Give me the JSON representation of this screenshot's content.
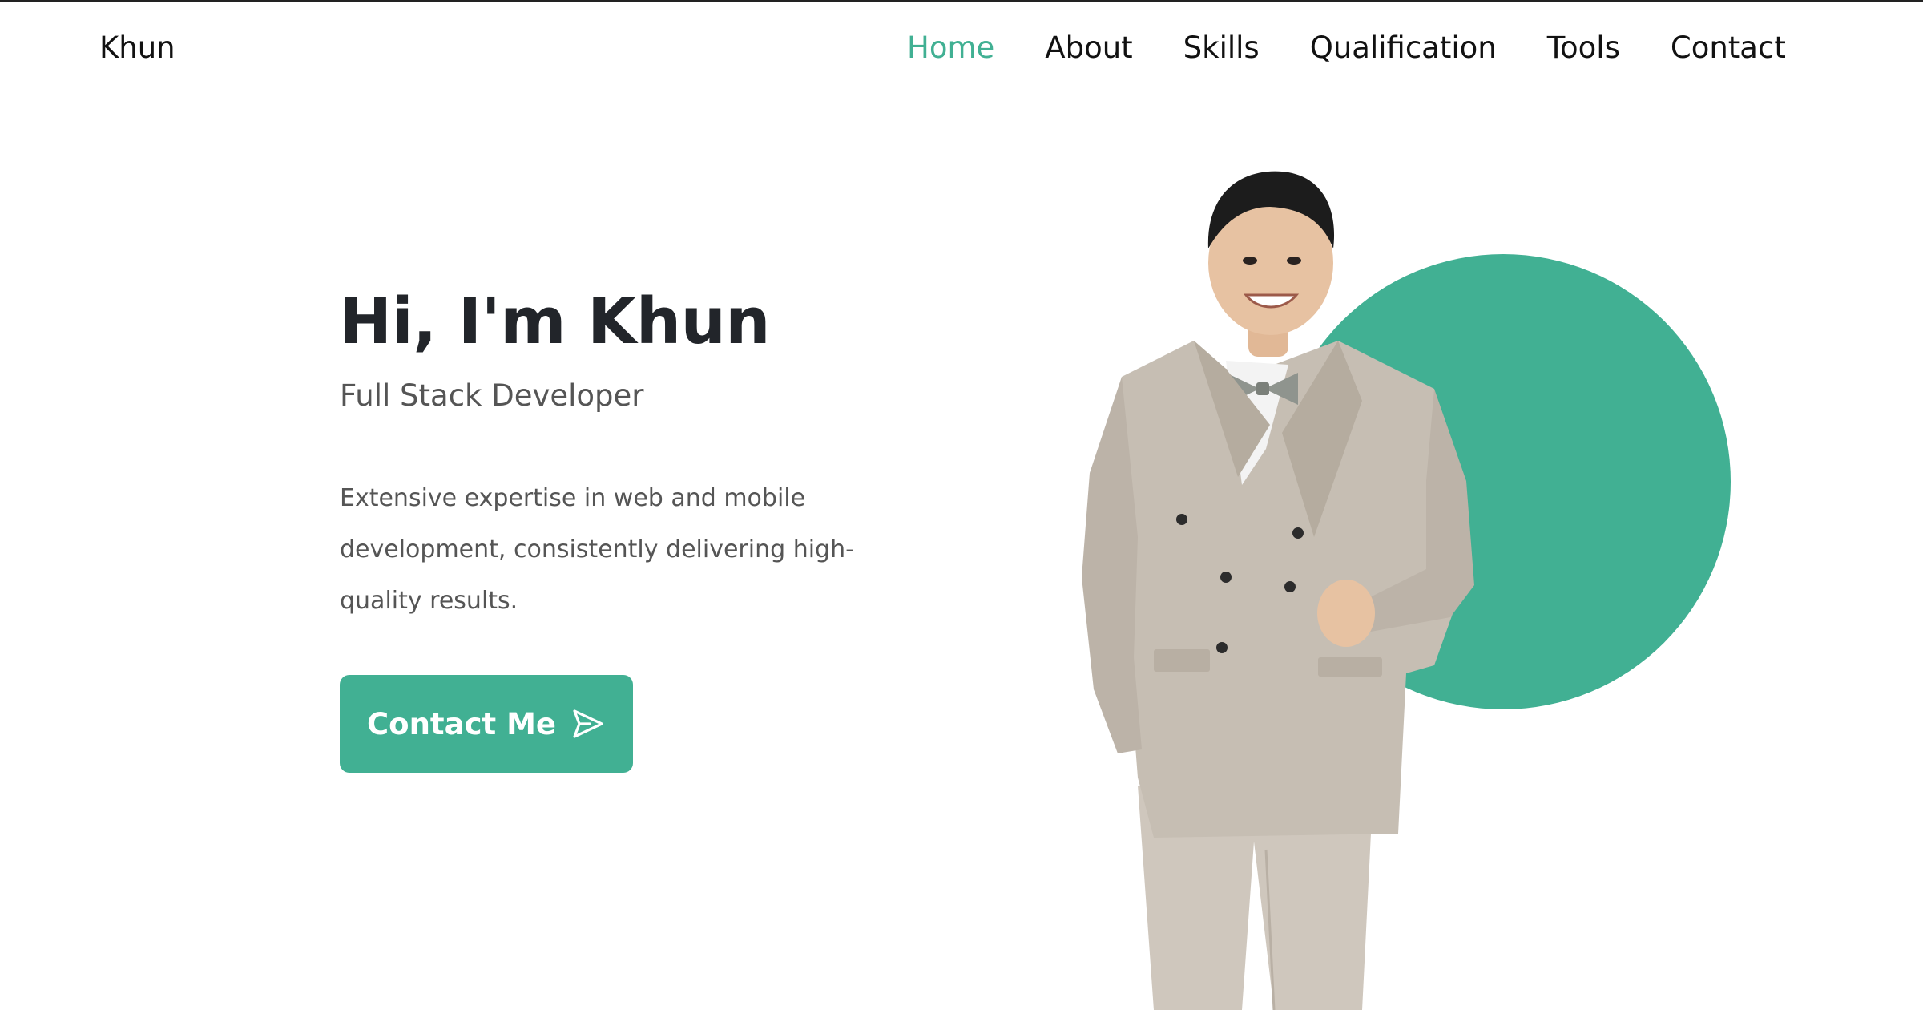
{
  "colors": {
    "accent": "#41b093",
    "heading": "#22252a",
    "body_text": "#555555",
    "background": "#ffffff"
  },
  "header": {
    "brand": "Khun",
    "nav": [
      {
        "label": "Home",
        "active": true
      },
      {
        "label": "About",
        "active": false
      },
      {
        "label": "Skills",
        "active": false
      },
      {
        "label": "Qualification",
        "active": false
      },
      {
        "label": "Tools",
        "active": false
      },
      {
        "label": "Contact",
        "active": false
      }
    ]
  },
  "hero": {
    "title": "Hi, I'm Khun",
    "subtitle": "Full Stack Developer",
    "description": "Extensive expertise in web and mobile development, consistently delivering high-quality results.",
    "cta_label": "Contact Me",
    "cta_icon": "send-icon",
    "image_icon": "profile-photo"
  }
}
